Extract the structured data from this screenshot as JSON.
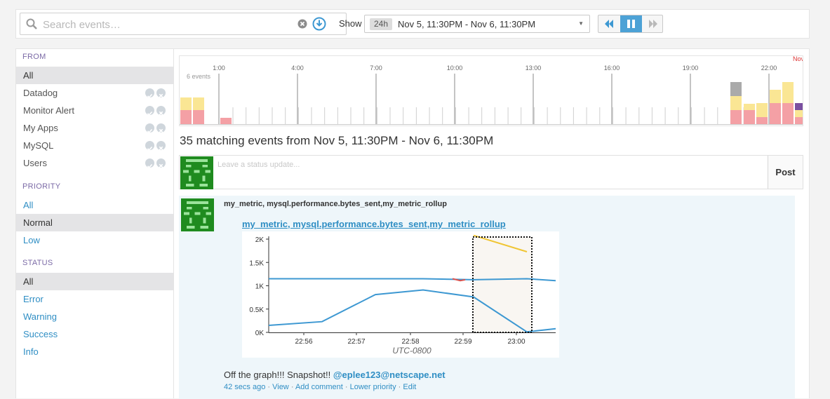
{
  "search": {
    "placeholder": "Search events…"
  },
  "range": {
    "show_label": "Show",
    "badge": "24h",
    "text": "Nov 5, 11:30PM - Nov 6, 11:30PM"
  },
  "sidebar": {
    "sections": [
      {
        "title": "FROM",
        "items": [
          {
            "label": "All",
            "active": true,
            "link": false,
            "actions": false
          },
          {
            "label": "Datadog",
            "active": false,
            "link": false,
            "actions": true
          },
          {
            "label": "Monitor Alert",
            "active": false,
            "link": false,
            "actions": true
          },
          {
            "label": "My Apps",
            "active": false,
            "link": false,
            "actions": true
          },
          {
            "label": "MySQL",
            "active": false,
            "link": false,
            "actions": true
          },
          {
            "label": "Users",
            "active": false,
            "link": false,
            "actions": true
          }
        ]
      },
      {
        "title": "PRIORITY",
        "items": [
          {
            "label": "All",
            "active": false,
            "link": true,
            "actions": false
          },
          {
            "label": "Normal",
            "active": true,
            "link": false,
            "actions": false
          },
          {
            "label": "Low",
            "active": false,
            "link": true,
            "actions": false
          }
        ]
      },
      {
        "title": "STATUS",
        "items": [
          {
            "label": "All",
            "active": true,
            "link": false,
            "actions": false
          },
          {
            "label": "Error",
            "active": false,
            "link": true,
            "actions": false
          },
          {
            "label": "Warning",
            "active": false,
            "link": true,
            "actions": false
          },
          {
            "label": "Success",
            "active": false,
            "link": true,
            "actions": false
          },
          {
            "label": "Info",
            "active": false,
            "link": true,
            "actions": false
          }
        ]
      }
    ]
  },
  "timeline": {
    "y_label": "6 events",
    "hour_labels": [
      "1:00",
      "4:00",
      "7:00",
      "10:00",
      "13:00",
      "16:00",
      "19:00",
      "22:00"
    ],
    "edge_label": "Nov",
    "colors": {
      "error": "#f4a0a5",
      "warning": "#fae694",
      "other": "#aaaaaa",
      "purple": "#7a4fa0"
    }
  },
  "heading": "35 matching events from Nov 5, 11:30PM - Nov 6, 11:30PM",
  "status_update": {
    "placeholder": "Leave a status update...",
    "post_label": "Post"
  },
  "event": {
    "title": "my_metric, mysql.performance.bytes_sent,my_metric_rollup",
    "graph_link": "my_metric, mysql.performance.bytes_sent,my_metric_rollup",
    "message": "Off the graph!!! Snapshot!!",
    "mention": "@eplee123@netscape.net",
    "time_ago": "42 secs ago",
    "actions": [
      "View",
      "Add comment",
      "Lower priority",
      "Edit"
    ]
  },
  "chart_data": {
    "type": "line",
    "y_ticks": [
      "2K",
      "1.5K",
      "1K",
      "0.5K",
      "0K"
    ],
    "x_ticks": [
      "22:56",
      "22:57",
      "22:58",
      "22:59",
      "23:00"
    ],
    "xlabel": "UTC-0800",
    "ylim": [
      0,
      2000
    ],
    "x": [
      "22:55",
      "22:56",
      "22:57",
      "22:58",
      "22:59",
      "23:00",
      "23:01"
    ],
    "series": [
      {
        "values": [
          1150,
          1150,
          1150,
          1150,
          1130,
          1150,
          1110
        ],
        "color": "#3d98d2"
      },
      {
        "values": [
          150,
          230,
          810,
          910,
          760,
          10,
          80
        ],
        "color": "#3d98d2"
      },
      {
        "values": [
          null,
          null,
          null,
          null,
          2080,
          1730,
          null
        ],
        "color": "#f0c533"
      }
    ],
    "highlight": "dotted box around 22:59-23:00",
    "grid": false
  }
}
